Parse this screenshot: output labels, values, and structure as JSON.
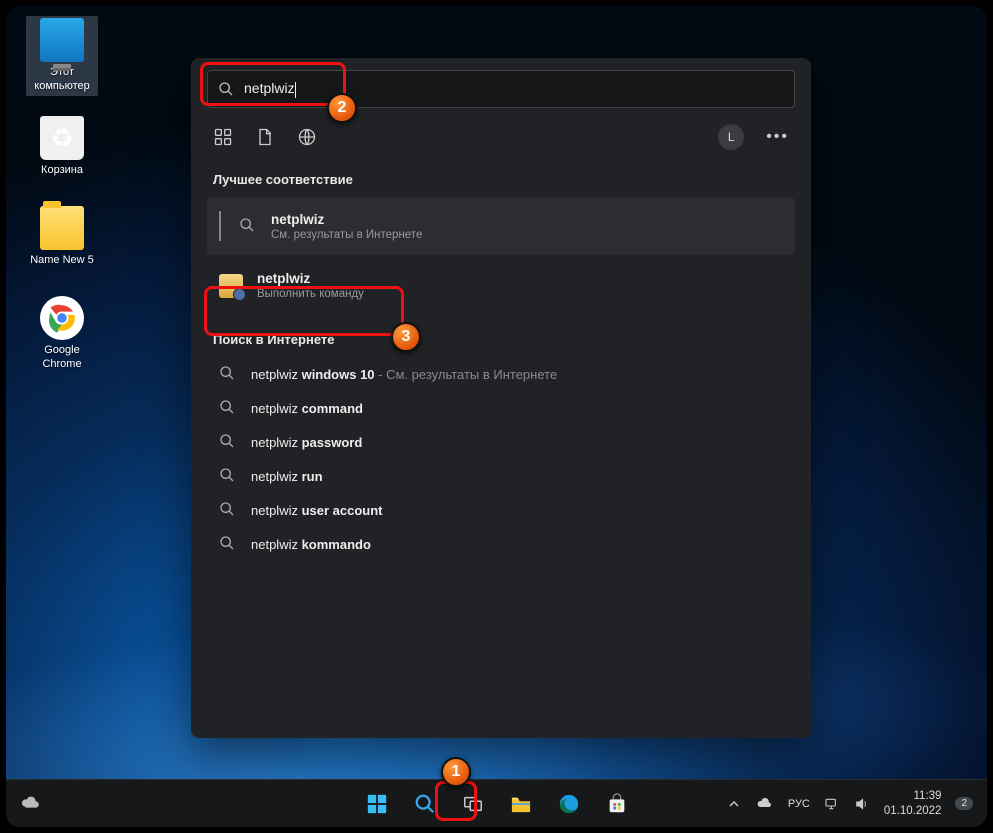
{
  "desktop": {
    "icons": {
      "this_pc": "Этот\nкомпьютер",
      "recycle_bin": "Корзина",
      "folder": "Name New 5",
      "chrome": "Google\nChrome"
    }
  },
  "search": {
    "query": "netplwiz",
    "filters": {
      "user_initial": "L"
    },
    "best_match_heading": "Лучшее соответствие",
    "best": {
      "title": "netplwiz",
      "sub": "См. результаты в Интернете"
    },
    "command": {
      "title": "netplwiz",
      "sub": "Выполнить команду"
    },
    "web_heading": "Поиск в Интернете",
    "web": [
      {
        "prefix": "netplwiz ",
        "bold": "windows 10",
        "hint": " - См. результаты в Интернете"
      },
      {
        "prefix": "netplwiz ",
        "bold": "command",
        "hint": ""
      },
      {
        "prefix": "netplwiz ",
        "bold": "password",
        "hint": ""
      },
      {
        "prefix": "netplwiz ",
        "bold": "run",
        "hint": ""
      },
      {
        "prefix": "netplwiz ",
        "bold": "user account",
        "hint": ""
      },
      {
        "prefix": "netplwiz ",
        "bold": "kommando",
        "hint": ""
      }
    ]
  },
  "taskbar": {
    "lang": "РУС",
    "time": "11:39",
    "date": "01.10.2022",
    "notif": "2"
  },
  "annotations": {
    "b1": "1",
    "b2": "2",
    "b3": "3"
  }
}
